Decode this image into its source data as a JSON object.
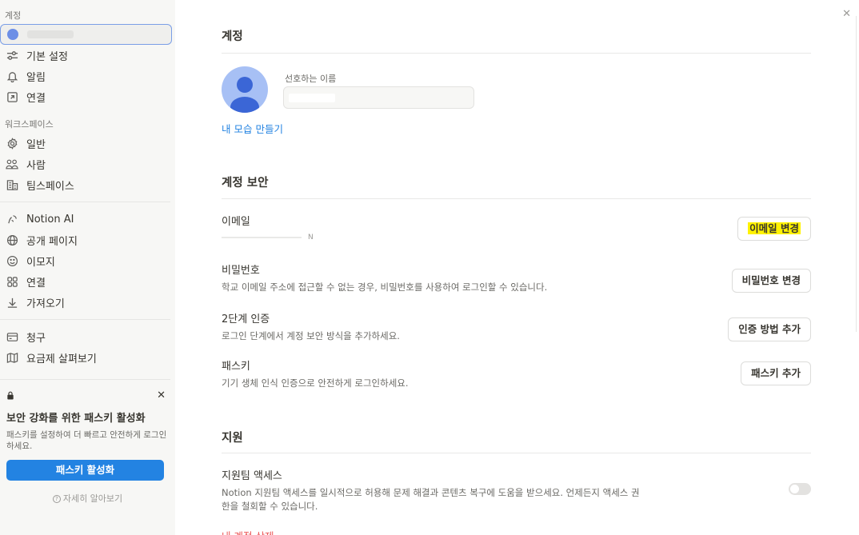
{
  "sidebar": {
    "account_section": "계정",
    "account_items": [
      {
        "label": "기본 설정",
        "icon": "sliders-icon"
      },
      {
        "label": "알림",
        "icon": "bell-icon"
      },
      {
        "label": "연결",
        "icon": "arrow-up-right-box-icon"
      }
    ],
    "workspace_section": "워크스페이스",
    "workspace_items": [
      {
        "label": "일반",
        "icon": "gear-icon"
      },
      {
        "label": "사람",
        "icon": "people-icon"
      },
      {
        "label": "팀스페이스",
        "icon": "building-icon"
      }
    ],
    "feature_items": [
      {
        "label": "Notion AI",
        "icon": "ai-face-icon"
      },
      {
        "label": "공개 페이지",
        "icon": "globe-icon"
      },
      {
        "label": "이모지",
        "icon": "smile-icon"
      },
      {
        "label": "연결",
        "icon": "grid-icon"
      },
      {
        "label": "가져오기",
        "icon": "download-icon"
      }
    ],
    "billing_items": [
      {
        "label": "청구",
        "icon": "card-icon"
      },
      {
        "label": "요금제 살펴보기",
        "icon": "map-icon"
      }
    ],
    "promo": {
      "title": "보안 강화를 위한 패스키 활성화",
      "desc": "패스키를 설정하여 더 빠르고 안전하게 로그인하세요.",
      "button": "패스키 활성화",
      "learn_more": "자세히 알아보기"
    }
  },
  "main": {
    "account_heading": "계정",
    "preferred_name_label": "선호하는 이름",
    "make_portrait_link": "내 모습 만들기",
    "security_heading": "계정 보안",
    "email": {
      "title": "이메일",
      "value": "N",
      "button": "이메일 변경"
    },
    "password": {
      "title": "비밀번호",
      "desc": "학교 이메일 주소에 접근할 수 없는 경우, 비밀번호를 사용하여 로그인할 수 있습니다.",
      "button": "비밀번호 변경"
    },
    "two_factor": {
      "title": "2단계 인증",
      "desc": "로그인 단계에서 계정 보안 방식을 추가하세요.",
      "button": "인증 방법 추가"
    },
    "passkey": {
      "title": "패스키",
      "desc": "기기 생체 인식 인증으로 안전하게 로그인하세요.",
      "button": "패스키 추가"
    },
    "support_heading": "지원",
    "support_access": {
      "title": "지원팀 액세스",
      "desc_line1": "Notion 지원팀 액세스를 일시적으로 허용해 문제 해결과 콘텐츠 복구에 도움을 받으세요. 언제든지 액세스 권",
      "desc_line2": "한을 철회할 수 있습니다.",
      "enabled": false
    },
    "delete_account": "내 계정 삭제"
  },
  "colors": {
    "accent": "#2383e2",
    "danger": "#eb5757",
    "highlight": "#fff200"
  }
}
